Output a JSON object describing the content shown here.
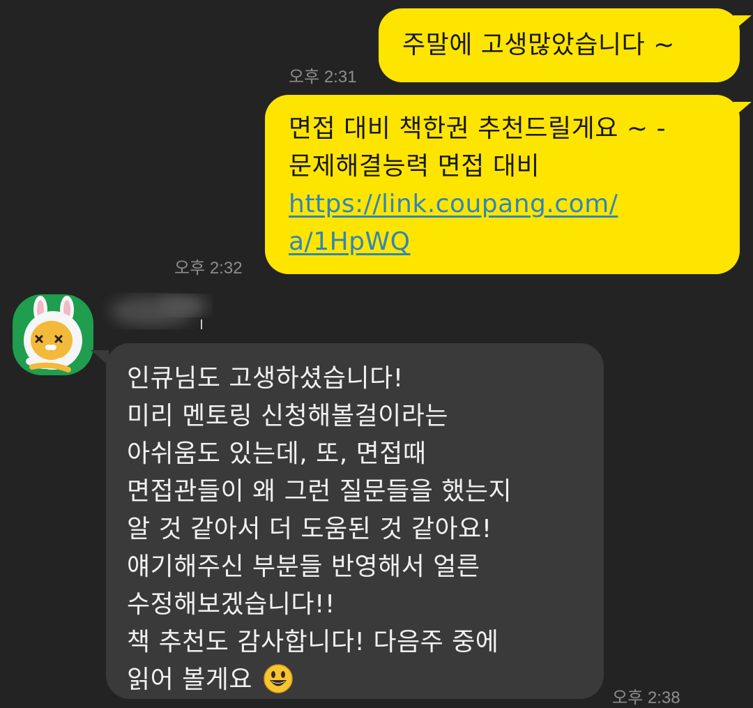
{
  "messages": [
    {
      "direction": "outgoing",
      "lines": [
        "주말에 고생많았습니다 ~"
      ],
      "time": "오후 2:31"
    },
    {
      "direction": "outgoing",
      "lines": [
        "면접 대비 책한권 추천드릴게요 ~ -",
        "문제해결능력 면접 대비"
      ],
      "link_lines": [
        "https://link.coupang.com/",
        "a/1HpWQ"
      ],
      "time": "오후 2:32"
    },
    {
      "direction": "incoming",
      "sender": {
        "avatar": "ryan-rabbit-hood-avatar",
        "name_obscured": true
      },
      "lines": [
        "인큐님도 고생하셨습니다!",
        "미리 멘토링 신청해볼걸이라는",
        "아쉬움도 있는데, 또, 면접때",
        "면접관들이 왜 그런 질문들을 했는지",
        "알 것 같아서 더 도움된 것 같아요!",
        "얘기해주신 부분들 반영해서 얼른",
        "수정해보겠습니다!!",
        "책 추천도 감사합니다! 다음주 중에",
        "읽어 볼게요"
      ],
      "emoji": "grinning-face-emoji",
      "time": "오후 2:38"
    }
  ],
  "colors": {
    "background": "#232323",
    "outgoing_bubble": "#fee500",
    "incoming_bubble": "#3a3a3a",
    "link": "#2f86b8",
    "timestamp": "#8e8e8e"
  }
}
